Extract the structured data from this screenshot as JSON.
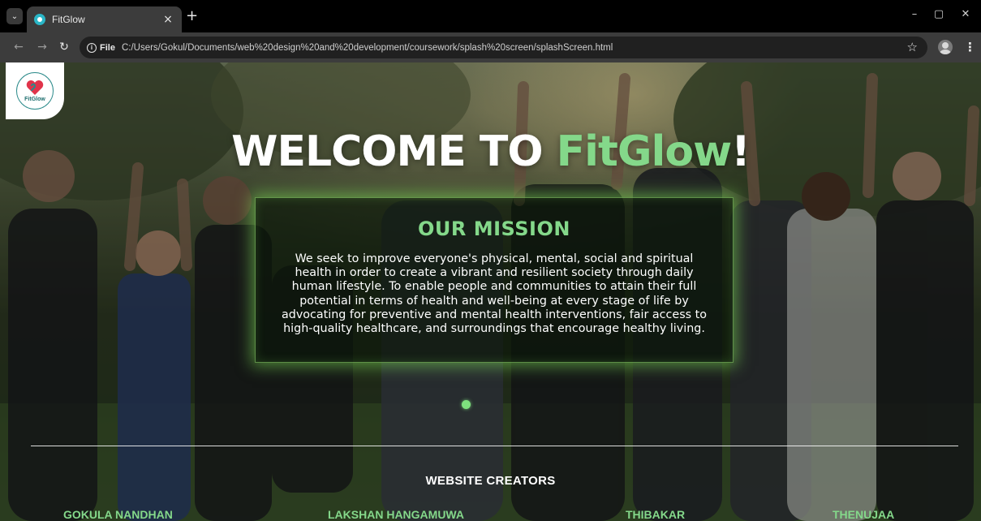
{
  "browser": {
    "tab_title": "FitGlow",
    "tab_close": "×",
    "new_tab": "+",
    "file_chip": "File",
    "url": "C:/Users/Gokul/Documents/web%20design%20and%20development/coursework/splash%20screen/splashScreen.html",
    "window_controls": [
      "–",
      "▢",
      "✕"
    ]
  },
  "page": {
    "logo_text": "FitGlow",
    "welcome_prefix": "WELCOME TO ",
    "welcome_brand": "FitGlow",
    "welcome_suffix": "!",
    "mission_title": "OUR MISSION",
    "mission_lines": [
      "We seek to improve everyone's physical, mental, social and spiritual",
      "health in order to create a vibrant and resilient society through daily",
      "human lifestyle. To enable people and communities to attain their full",
      "potential in terms of health and well-being at every stage of life by",
      "advocating for preventive and mental health interventions, fair access to",
      "high-quality healthcare, and surroundings that encourage healthy living."
    ],
    "creators_title": "WEBSITE CREATORS",
    "creators": [
      "GOKULA NANDHAN",
      "LAKSHAN HANGAMUWA",
      "THIBAKAR",
      "THENUJAA"
    ]
  },
  "colors": {
    "accent_green": "#84d88a",
    "chrome_dark": "#3c3c3c",
    "omnibox": "#202020"
  }
}
